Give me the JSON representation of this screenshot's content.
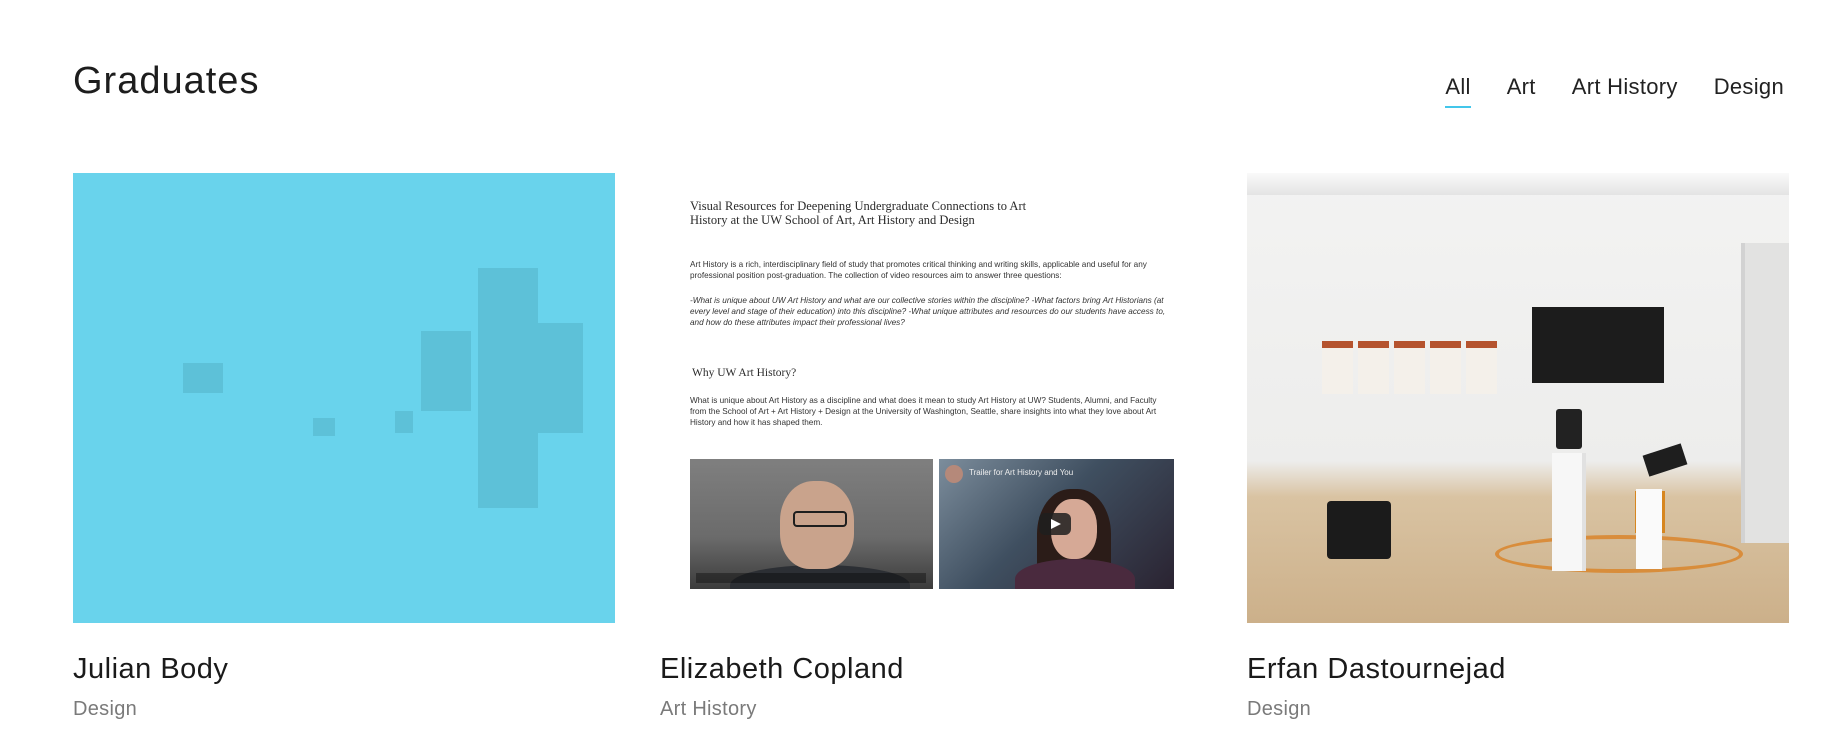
{
  "section": {
    "title": "Graduates"
  },
  "filters": [
    {
      "label": "All",
      "active": true
    },
    {
      "label": "Art",
      "active": false
    },
    {
      "label": "Art History",
      "active": false
    },
    {
      "label": "Design",
      "active": false
    }
  ],
  "accent_color": "#43c6ea",
  "cards": [
    {
      "name": "Julian Body",
      "category": "Design",
      "overlay_color": "#69d3ec"
    },
    {
      "name": "Elizabeth Copland",
      "category": "Art History",
      "thumbnail_doc": {
        "title": "Visual Resources for Deepening Undergraduate Connections to Art History at the UW School of Art, Art History and Design",
        "intro": "Art History is a rich, interdisciplinary field of study that promotes critical thinking and writing skills, applicable and useful for any professional position post-graduation. The collection of video resources aim to answer three questions:",
        "questions": "-What is unique about UW Art History and what are our collective stories within the discipline? -What factors bring Art Historians (at every level and stage of their education) into this discipline? -What unique attributes and resources do our students have access to, and how do these attributes impact their professional lives?",
        "heading": "Why UW Art History?",
        "body": "What is unique about Art History as a discipline and what does it mean to study Art History at UW? Students, Alumni, and Faculty from the School of Art + Art History + Design at the University of Washington, Seattle, share insights into what they love about Art History and how it has shaped them.",
        "video_title": "Trailer for Art History and You"
      }
    },
    {
      "name": "Erfan Dastournejad",
      "category": "Design"
    }
  ]
}
